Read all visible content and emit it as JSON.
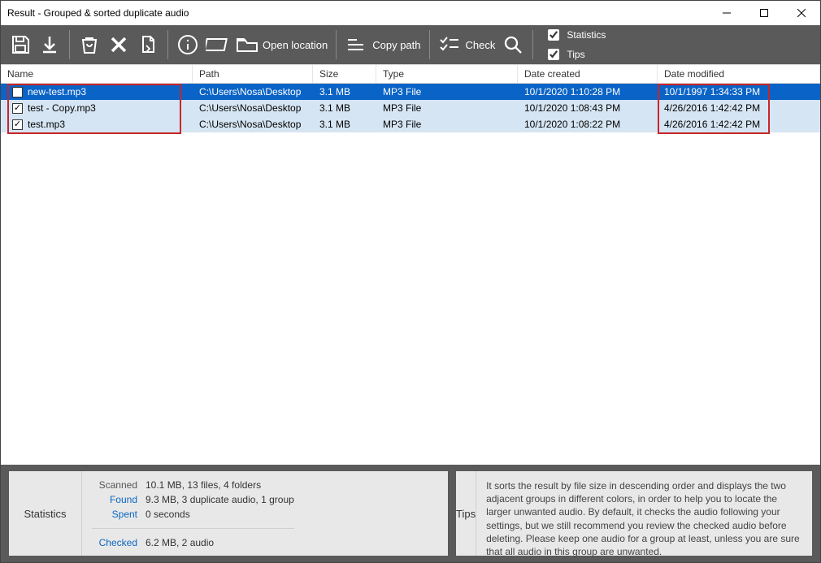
{
  "window": {
    "title": "Result - Grouped & sorted duplicate audio"
  },
  "toolbar": {
    "open_location": "Open location",
    "copy_path": "Copy path",
    "check": "Check",
    "right": {
      "statistics": "Statistics",
      "tips": "Tips"
    }
  },
  "columns": {
    "name": "Name",
    "path": "Path",
    "size": "Size",
    "type": "Type",
    "created": "Date created",
    "modified": "Date modified"
  },
  "rows": [
    {
      "checked": false,
      "selected": true,
      "name": "new-test.mp3",
      "path": "C:\\Users\\Nosa\\Desktop",
      "size": "3.1 MB",
      "type": "MP3 File",
      "created": "10/1/2020 1:10:28 PM",
      "modified": "10/1/1997 1:34:33 PM"
    },
    {
      "checked": true,
      "selected": false,
      "name": "test - Copy.mp3",
      "path": "C:\\Users\\Nosa\\Desktop",
      "size": "3.1 MB",
      "type": "MP3 File",
      "created": "10/1/2020 1:08:43 PM",
      "modified": "4/26/2016 1:42:42 PM"
    },
    {
      "checked": true,
      "selected": false,
      "name": "test.mp3",
      "path": "C:\\Users\\Nosa\\Desktop",
      "size": "3.1 MB",
      "type": "MP3 File",
      "created": "10/1/2020 1:08:22 PM",
      "modified": "4/26/2016 1:42:42 PM"
    }
  ],
  "panels": {
    "statistics": {
      "title": "Statistics",
      "scanned_lbl": "Scanned",
      "scanned_val": "10.1 MB, 13 files, 4 folders",
      "found_lbl": "Found",
      "found_val": "9.3 MB, 3 duplicate audio, 1 group",
      "spent_lbl": "Spent",
      "spent_val": "0 seconds",
      "checked_lbl": "Checked",
      "checked_val": "6.2 MB, 2 audio"
    },
    "tips": {
      "title": "Tips",
      "text": "It sorts the result by file size in descending order and displays the two adjacent groups in different colors, in order to help you to locate the larger unwanted audio. By default, it checks the audio following your settings, but we still recommend you review the checked audio before deleting. Please keep one audio for a group at least, unless you are sure that all audio in this group are unwanted."
    }
  }
}
